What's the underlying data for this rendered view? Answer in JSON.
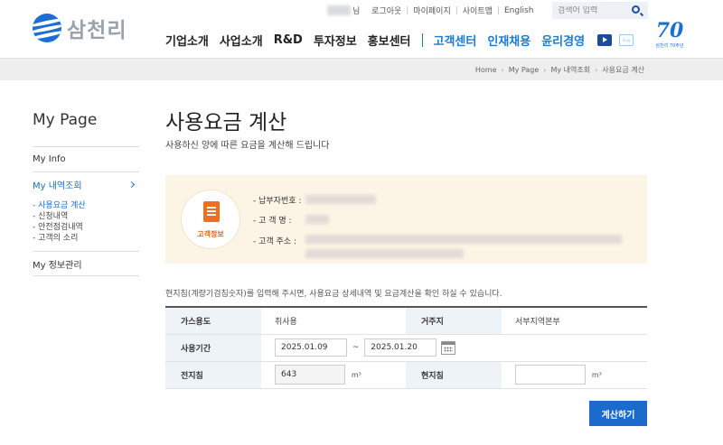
{
  "header": {
    "logo_text": "삼천리",
    "util_links": [
      "로그아웃",
      "마이페이지",
      "사이트맵",
      "English"
    ],
    "user_suffix": "님",
    "search_placeholder": "검색어 입력",
    "nav": [
      "기업소개",
      "사업소개",
      "R&D",
      "투자정보",
      "홍보센터",
      "고객센터",
      "인재채용",
      "윤리경영"
    ],
    "blog_label": "blog",
    "anniversary_number": "70",
    "anniversary_text": "삼천리 70주년"
  },
  "breadcrumb": [
    "Home",
    "My Page",
    "My 내역조회",
    "사용요금 계산"
  ],
  "sidebar": {
    "title": "My Page",
    "items": [
      {
        "label": "My Info"
      },
      {
        "label": "My 내역조회"
      },
      {
        "label": "My 정보관리"
      }
    ],
    "sub_items": [
      "- 사용요금 계산",
      "- 신청내역",
      "- 안전점검내역",
      "- 고객의 소리"
    ]
  },
  "main": {
    "title": "사용요금 계산",
    "subtitle": "사용하신 양에 따른 요금을 계산해 드립니다",
    "info": {
      "badge_label": "고객정보",
      "rows": [
        {
          "label": "- 납부자번호 :"
        },
        {
          "label": "- 고   객   명 :"
        },
        {
          "label": "- 고객 주소 :"
        }
      ]
    },
    "note": "현지침(계량기검침숫자)를 입력해 주시면, 사용요금 상세내역 및 요금계산을 확인 하실 수 있습니다.",
    "table": {
      "gas_use_label": "가스용도",
      "gas_use_value": "취사용",
      "residence_label": "거주지",
      "residence_value": "서부지역본부",
      "period_label": "사용기간",
      "period_start": "2025.01.09",
      "period_sep": "~",
      "period_end": "2025.01.20",
      "prev_reading_label": "전지침",
      "prev_reading_value": "643",
      "curr_reading_label": "현지침",
      "curr_reading_value": "",
      "unit": "m³"
    },
    "calc_button": "계산하기"
  }
}
